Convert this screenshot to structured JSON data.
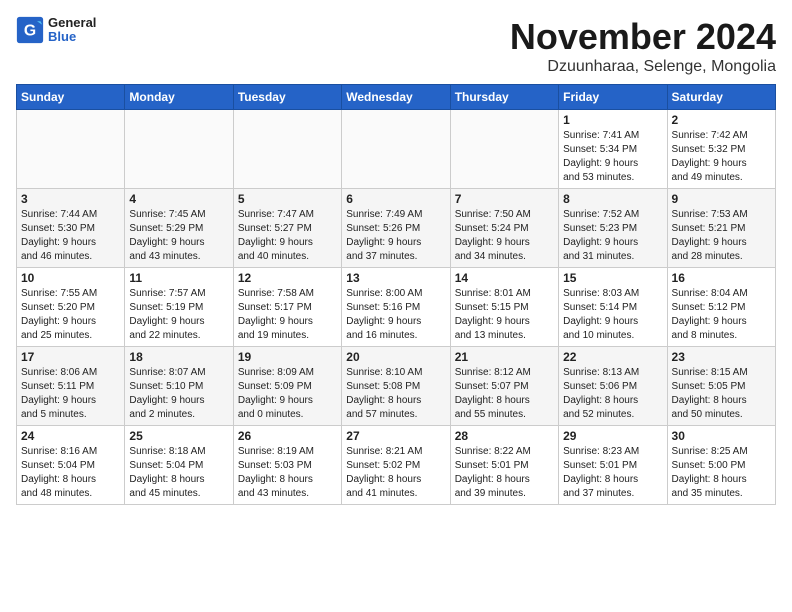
{
  "logo": {
    "general": "General",
    "blue": "Blue"
  },
  "title": "November 2024",
  "location": "Dzuunharaa, Selenge, Mongolia",
  "days_of_week": [
    "Sunday",
    "Monday",
    "Tuesday",
    "Wednesday",
    "Thursday",
    "Friday",
    "Saturday"
  ],
  "weeks": [
    [
      {
        "day": "",
        "details": ""
      },
      {
        "day": "",
        "details": ""
      },
      {
        "day": "",
        "details": ""
      },
      {
        "day": "",
        "details": ""
      },
      {
        "day": "",
        "details": ""
      },
      {
        "day": "1",
        "details": "Sunrise: 7:41 AM\nSunset: 5:34 PM\nDaylight: 9 hours\nand 53 minutes."
      },
      {
        "day": "2",
        "details": "Sunrise: 7:42 AM\nSunset: 5:32 PM\nDaylight: 9 hours\nand 49 minutes."
      }
    ],
    [
      {
        "day": "3",
        "details": "Sunrise: 7:44 AM\nSunset: 5:30 PM\nDaylight: 9 hours\nand 46 minutes."
      },
      {
        "day": "4",
        "details": "Sunrise: 7:45 AM\nSunset: 5:29 PM\nDaylight: 9 hours\nand 43 minutes."
      },
      {
        "day": "5",
        "details": "Sunrise: 7:47 AM\nSunset: 5:27 PM\nDaylight: 9 hours\nand 40 minutes."
      },
      {
        "day": "6",
        "details": "Sunrise: 7:49 AM\nSunset: 5:26 PM\nDaylight: 9 hours\nand 37 minutes."
      },
      {
        "day": "7",
        "details": "Sunrise: 7:50 AM\nSunset: 5:24 PM\nDaylight: 9 hours\nand 34 minutes."
      },
      {
        "day": "8",
        "details": "Sunrise: 7:52 AM\nSunset: 5:23 PM\nDaylight: 9 hours\nand 31 minutes."
      },
      {
        "day": "9",
        "details": "Sunrise: 7:53 AM\nSunset: 5:21 PM\nDaylight: 9 hours\nand 28 minutes."
      }
    ],
    [
      {
        "day": "10",
        "details": "Sunrise: 7:55 AM\nSunset: 5:20 PM\nDaylight: 9 hours\nand 25 minutes."
      },
      {
        "day": "11",
        "details": "Sunrise: 7:57 AM\nSunset: 5:19 PM\nDaylight: 9 hours\nand 22 minutes."
      },
      {
        "day": "12",
        "details": "Sunrise: 7:58 AM\nSunset: 5:17 PM\nDaylight: 9 hours\nand 19 minutes."
      },
      {
        "day": "13",
        "details": "Sunrise: 8:00 AM\nSunset: 5:16 PM\nDaylight: 9 hours\nand 16 minutes."
      },
      {
        "day": "14",
        "details": "Sunrise: 8:01 AM\nSunset: 5:15 PM\nDaylight: 9 hours\nand 13 minutes."
      },
      {
        "day": "15",
        "details": "Sunrise: 8:03 AM\nSunset: 5:14 PM\nDaylight: 9 hours\nand 10 minutes."
      },
      {
        "day": "16",
        "details": "Sunrise: 8:04 AM\nSunset: 5:12 PM\nDaylight: 9 hours\nand 8 minutes."
      }
    ],
    [
      {
        "day": "17",
        "details": "Sunrise: 8:06 AM\nSunset: 5:11 PM\nDaylight: 9 hours\nand 5 minutes."
      },
      {
        "day": "18",
        "details": "Sunrise: 8:07 AM\nSunset: 5:10 PM\nDaylight: 9 hours\nand 2 minutes."
      },
      {
        "day": "19",
        "details": "Sunrise: 8:09 AM\nSunset: 5:09 PM\nDaylight: 9 hours\nand 0 minutes."
      },
      {
        "day": "20",
        "details": "Sunrise: 8:10 AM\nSunset: 5:08 PM\nDaylight: 8 hours\nand 57 minutes."
      },
      {
        "day": "21",
        "details": "Sunrise: 8:12 AM\nSunset: 5:07 PM\nDaylight: 8 hours\nand 55 minutes."
      },
      {
        "day": "22",
        "details": "Sunrise: 8:13 AM\nSunset: 5:06 PM\nDaylight: 8 hours\nand 52 minutes."
      },
      {
        "day": "23",
        "details": "Sunrise: 8:15 AM\nSunset: 5:05 PM\nDaylight: 8 hours\nand 50 minutes."
      }
    ],
    [
      {
        "day": "24",
        "details": "Sunrise: 8:16 AM\nSunset: 5:04 PM\nDaylight: 8 hours\nand 48 minutes."
      },
      {
        "day": "25",
        "details": "Sunrise: 8:18 AM\nSunset: 5:04 PM\nDaylight: 8 hours\nand 45 minutes."
      },
      {
        "day": "26",
        "details": "Sunrise: 8:19 AM\nSunset: 5:03 PM\nDaylight: 8 hours\nand 43 minutes."
      },
      {
        "day": "27",
        "details": "Sunrise: 8:21 AM\nSunset: 5:02 PM\nDaylight: 8 hours\nand 41 minutes."
      },
      {
        "day": "28",
        "details": "Sunrise: 8:22 AM\nSunset: 5:01 PM\nDaylight: 8 hours\nand 39 minutes."
      },
      {
        "day": "29",
        "details": "Sunrise: 8:23 AM\nSunset: 5:01 PM\nDaylight: 8 hours\nand 37 minutes."
      },
      {
        "day": "30",
        "details": "Sunrise: 8:25 AM\nSunset: 5:00 PM\nDaylight: 8 hours\nand 35 minutes."
      }
    ]
  ]
}
